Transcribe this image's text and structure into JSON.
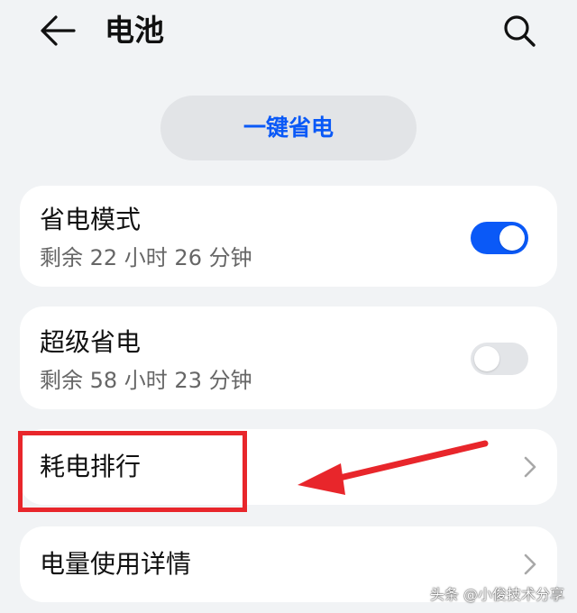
{
  "header": {
    "title": "电池",
    "back_icon": "arrow-left-icon",
    "search_icon": "search-icon"
  },
  "oneclick": {
    "label": "一键省电"
  },
  "items": [
    {
      "title": "省电模式",
      "subtitle": "剩余 22 小时 26 分钟",
      "control": "toggle",
      "on": true
    },
    {
      "title": "超级省电",
      "subtitle": "剩余 58 小时 23 分钟",
      "control": "toggle",
      "on": false
    },
    {
      "title": "耗电排行",
      "control": "chevron-right-icon"
    },
    {
      "title": "电量使用详情",
      "control": "chevron-right-icon"
    }
  ],
  "annotation": {
    "highlight_color": "#e8262b"
  },
  "colors": {
    "accent": "#0a59f7",
    "background": "#f1f3f5",
    "card": "#ffffff"
  },
  "watermark": "头条 @小俊技术分享"
}
